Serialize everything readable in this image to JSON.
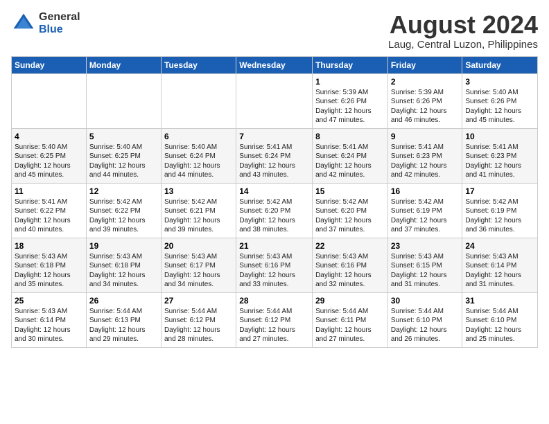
{
  "header": {
    "logo_general": "General",
    "logo_blue": "Blue",
    "month_year": "August 2024",
    "location": "Laug, Central Luzon, Philippines"
  },
  "weekdays": [
    "Sunday",
    "Monday",
    "Tuesday",
    "Wednesday",
    "Thursday",
    "Friday",
    "Saturday"
  ],
  "weeks": [
    [
      {
        "day": "",
        "content": ""
      },
      {
        "day": "",
        "content": ""
      },
      {
        "day": "",
        "content": ""
      },
      {
        "day": "",
        "content": ""
      },
      {
        "day": "1",
        "content": "Sunrise: 5:39 AM\nSunset: 6:26 PM\nDaylight: 12 hours\nand 47 minutes."
      },
      {
        "day": "2",
        "content": "Sunrise: 5:39 AM\nSunset: 6:26 PM\nDaylight: 12 hours\nand 46 minutes."
      },
      {
        "day": "3",
        "content": "Sunrise: 5:40 AM\nSunset: 6:26 PM\nDaylight: 12 hours\nand 45 minutes."
      }
    ],
    [
      {
        "day": "4",
        "content": "Sunrise: 5:40 AM\nSunset: 6:25 PM\nDaylight: 12 hours\nand 45 minutes."
      },
      {
        "day": "5",
        "content": "Sunrise: 5:40 AM\nSunset: 6:25 PM\nDaylight: 12 hours\nand 44 minutes."
      },
      {
        "day": "6",
        "content": "Sunrise: 5:40 AM\nSunset: 6:24 PM\nDaylight: 12 hours\nand 44 minutes."
      },
      {
        "day": "7",
        "content": "Sunrise: 5:41 AM\nSunset: 6:24 PM\nDaylight: 12 hours\nand 43 minutes."
      },
      {
        "day": "8",
        "content": "Sunrise: 5:41 AM\nSunset: 6:24 PM\nDaylight: 12 hours\nand 42 minutes."
      },
      {
        "day": "9",
        "content": "Sunrise: 5:41 AM\nSunset: 6:23 PM\nDaylight: 12 hours\nand 42 minutes."
      },
      {
        "day": "10",
        "content": "Sunrise: 5:41 AM\nSunset: 6:23 PM\nDaylight: 12 hours\nand 41 minutes."
      }
    ],
    [
      {
        "day": "11",
        "content": "Sunrise: 5:41 AM\nSunset: 6:22 PM\nDaylight: 12 hours\nand 40 minutes."
      },
      {
        "day": "12",
        "content": "Sunrise: 5:42 AM\nSunset: 6:22 PM\nDaylight: 12 hours\nand 39 minutes."
      },
      {
        "day": "13",
        "content": "Sunrise: 5:42 AM\nSunset: 6:21 PM\nDaylight: 12 hours\nand 39 minutes."
      },
      {
        "day": "14",
        "content": "Sunrise: 5:42 AM\nSunset: 6:20 PM\nDaylight: 12 hours\nand 38 minutes."
      },
      {
        "day": "15",
        "content": "Sunrise: 5:42 AM\nSunset: 6:20 PM\nDaylight: 12 hours\nand 37 minutes."
      },
      {
        "day": "16",
        "content": "Sunrise: 5:42 AM\nSunset: 6:19 PM\nDaylight: 12 hours\nand 37 minutes."
      },
      {
        "day": "17",
        "content": "Sunrise: 5:42 AM\nSunset: 6:19 PM\nDaylight: 12 hours\nand 36 minutes."
      }
    ],
    [
      {
        "day": "18",
        "content": "Sunrise: 5:43 AM\nSunset: 6:18 PM\nDaylight: 12 hours\nand 35 minutes."
      },
      {
        "day": "19",
        "content": "Sunrise: 5:43 AM\nSunset: 6:18 PM\nDaylight: 12 hours\nand 34 minutes."
      },
      {
        "day": "20",
        "content": "Sunrise: 5:43 AM\nSunset: 6:17 PM\nDaylight: 12 hours\nand 34 minutes."
      },
      {
        "day": "21",
        "content": "Sunrise: 5:43 AM\nSunset: 6:16 PM\nDaylight: 12 hours\nand 33 minutes."
      },
      {
        "day": "22",
        "content": "Sunrise: 5:43 AM\nSunset: 6:16 PM\nDaylight: 12 hours\nand 32 minutes."
      },
      {
        "day": "23",
        "content": "Sunrise: 5:43 AM\nSunset: 6:15 PM\nDaylight: 12 hours\nand 31 minutes."
      },
      {
        "day": "24",
        "content": "Sunrise: 5:43 AM\nSunset: 6:14 PM\nDaylight: 12 hours\nand 31 minutes."
      }
    ],
    [
      {
        "day": "25",
        "content": "Sunrise: 5:43 AM\nSunset: 6:14 PM\nDaylight: 12 hours\nand 30 minutes."
      },
      {
        "day": "26",
        "content": "Sunrise: 5:44 AM\nSunset: 6:13 PM\nDaylight: 12 hours\nand 29 minutes."
      },
      {
        "day": "27",
        "content": "Sunrise: 5:44 AM\nSunset: 6:12 PM\nDaylight: 12 hours\nand 28 minutes."
      },
      {
        "day": "28",
        "content": "Sunrise: 5:44 AM\nSunset: 6:12 PM\nDaylight: 12 hours\nand 27 minutes."
      },
      {
        "day": "29",
        "content": "Sunrise: 5:44 AM\nSunset: 6:11 PM\nDaylight: 12 hours\nand 27 minutes."
      },
      {
        "day": "30",
        "content": "Sunrise: 5:44 AM\nSunset: 6:10 PM\nDaylight: 12 hours\nand 26 minutes."
      },
      {
        "day": "31",
        "content": "Sunrise: 5:44 AM\nSunset: 6:10 PM\nDaylight: 12 hours\nand 25 minutes."
      }
    ]
  ]
}
